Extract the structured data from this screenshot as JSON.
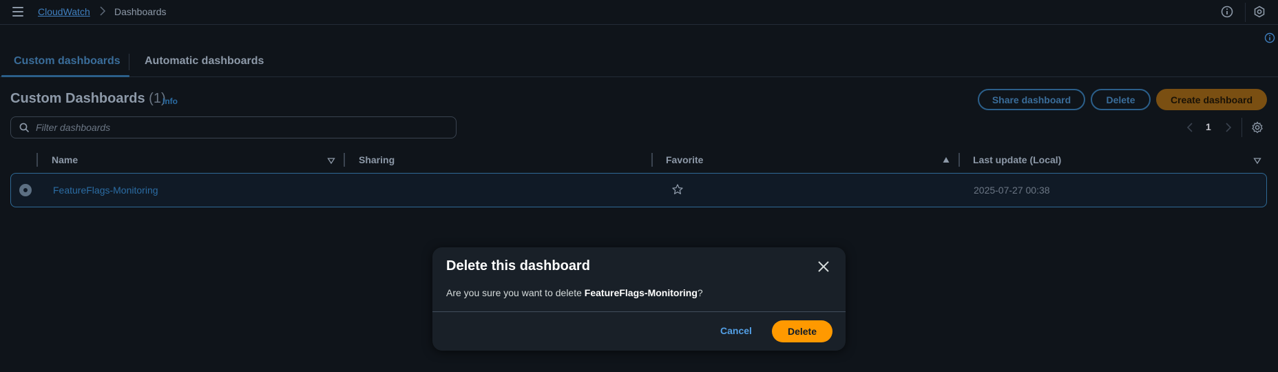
{
  "header": {
    "menu_icon": "menu-icon",
    "breadcrumb_service": "CloudWatch",
    "breadcrumb_separator_icon": "chevron-right-icon",
    "breadcrumb_current": "Dashboards",
    "right_icons": [
      "info-icon",
      "settings-cog-icon"
    ]
  },
  "tabs": [
    {
      "label": "Custom dashboards",
      "active": true
    },
    {
      "label": "Automatic dashboards",
      "active": false
    }
  ],
  "section": {
    "title": "Custom Dashboards",
    "count": "(1)",
    "info_link": "Info"
  },
  "actions": {
    "share_label": "Share dashboard",
    "delete_label": "Delete",
    "create_label": "Create dashboard"
  },
  "filter": {
    "placeholder": "Filter dashboards",
    "value": ""
  },
  "pagination": {
    "current_page": "1"
  },
  "table": {
    "columns": [
      "Name",
      "Sharing",
      "Favorite",
      "Last update (Local)"
    ],
    "rows": [
      {
        "name": "FeatureFlags-Monitoring",
        "sharing": "",
        "favorite": false,
        "last_update": "2025-07-27 00:38",
        "selected": true
      }
    ]
  },
  "modal": {
    "title": "Delete this dashboard",
    "message_prefix": "Are you sure you want to delete ",
    "dashboard_name": "FeatureFlags-Monitoring",
    "message_suffix": "?",
    "cancel_label": "Cancel",
    "delete_label": "Delete"
  },
  "colors": {
    "background": "#0f141a",
    "link": "#539fe5",
    "primary": "#ff9900",
    "dimmed_primary": "#7a4f12"
  }
}
